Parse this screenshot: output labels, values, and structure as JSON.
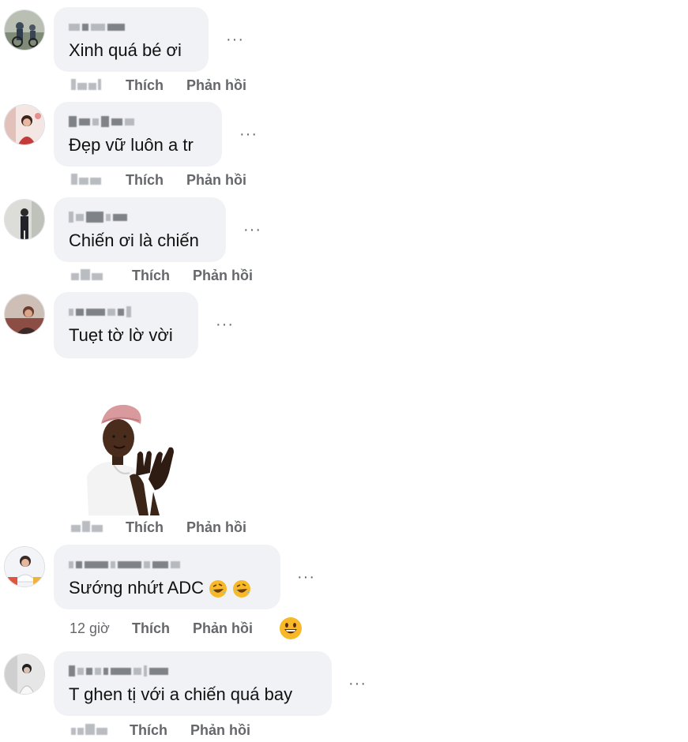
{
  "actions": {
    "like_label": "Thích",
    "reply_label": "Phản hồi",
    "more_label": "···"
  },
  "comments": [
    {
      "text": "Xinh quá bé ơi"
    },
    {
      "text": "Đẹp vữ luôn a tr"
    },
    {
      "text": "Chiến ơi là chiến"
    },
    {
      "text": "Tuẹt tờ lờ vời"
    },
    {
      "sticker": "clapping-character-sticker"
    },
    {
      "text": "Sướng nhứt ADC",
      "time": "12 giờ",
      "emojis": [
        "rofl-emoji",
        "rofl-emoji"
      ],
      "reaction": "grinning-emoji"
    },
    {
      "text": "T ghen tị với a chiến quá bay"
    }
  ],
  "colors": {
    "bubble": "#f0f2f5",
    "meta": "#65676b",
    "text": "#050505",
    "emoji_yellow": "#f7b928"
  }
}
